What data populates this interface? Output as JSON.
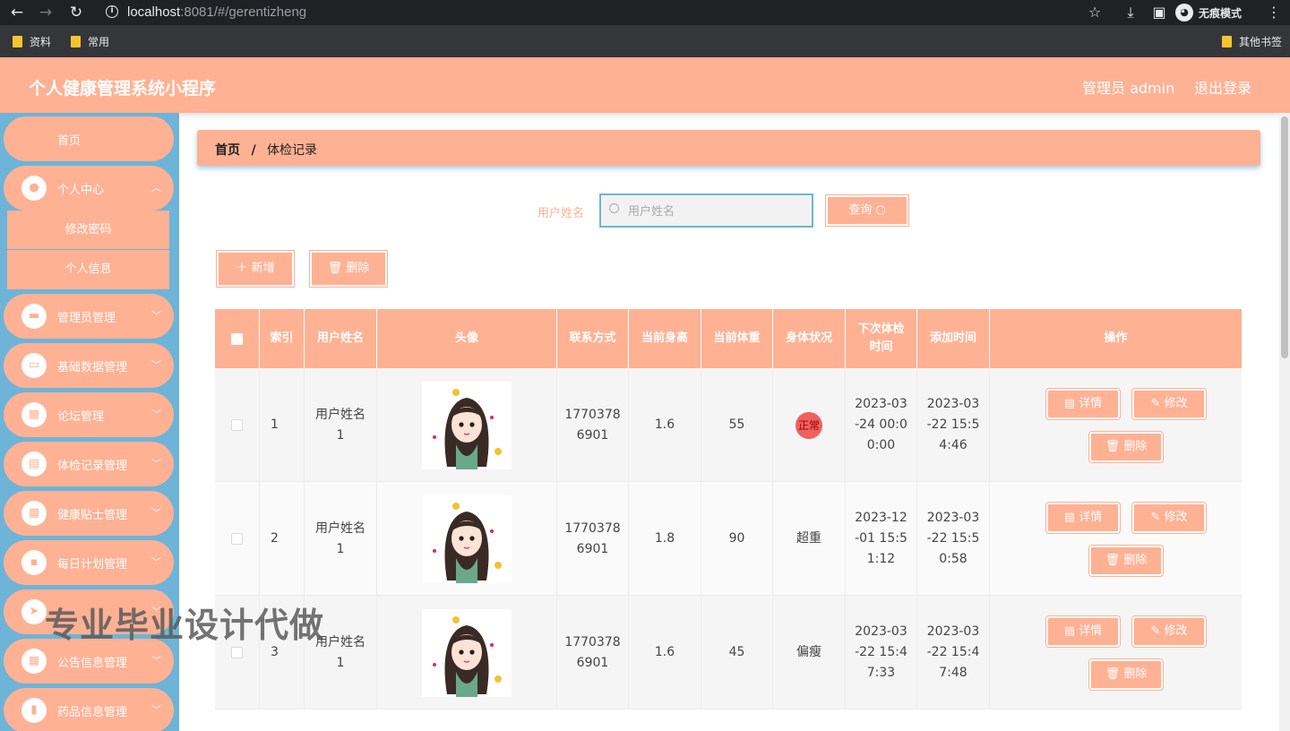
{
  "browser": {
    "url_host": "localhost",
    "url_rest": ":8081/#/gerentizheng",
    "incognito_label": "无痕模式",
    "bookmarks": [
      "资料",
      "常用"
    ],
    "other_bookmarks": "其他书签"
  },
  "header": {
    "title": "个人健康管理系统小程序",
    "user": "管理员 admin",
    "logout": "退出登录"
  },
  "sidebar": {
    "home": "首页",
    "items": [
      {
        "label": "个人中心",
        "icon": "user-icon"
      },
      {
        "label": "管理员管理",
        "icon": "ticket-icon"
      },
      {
        "label": "基础数据管理",
        "icon": "monitor-icon"
      },
      {
        "label": "论坛管理",
        "icon": "grid-icon"
      },
      {
        "label": "体检记录管理",
        "icon": "chart-icon"
      },
      {
        "label": "健康贴士管理",
        "icon": "grid-icon"
      },
      {
        "label": "每日计划管理",
        "icon": "message-icon"
      },
      {
        "label": "",
        "icon": "send-icon"
      },
      {
        "label": "公告信息管理",
        "icon": "grid-icon"
      },
      {
        "label": "药品信息管理",
        "icon": "clipboard-icon"
      }
    ],
    "submenu": [
      "修改密码",
      "个人信息"
    ]
  },
  "breadcrumb": {
    "home": "首页",
    "sep": "/",
    "current": "体检记录"
  },
  "search": {
    "label": "用户姓名",
    "placeholder": "用户姓名",
    "button": "查询"
  },
  "toolbar": {
    "add": "新增",
    "delete": "删除"
  },
  "table": {
    "headers": [
      "索引",
      "用户姓名",
      "头像",
      "联系方式",
      "当前身高",
      "当前体重",
      "身体状况",
      "下次体检时间",
      "添加时间",
      "操作"
    ],
    "rows": [
      {
        "index": "1",
        "name": "用户姓名1",
        "phone": "17703786901",
        "height": "1.6",
        "weight": "55",
        "status": "正常",
        "next": "2023-03-24 00:00:00",
        "added": "2023-03-22 15:54:46"
      },
      {
        "index": "2",
        "name": "用户姓名1",
        "phone": "17703786901",
        "height": "1.8",
        "weight": "90",
        "status": "超重",
        "next": "2023-12-01 15:51:12",
        "added": "2023-03-22 15:50:58"
      },
      {
        "index": "3",
        "name": "用户姓名1",
        "phone": "17703786901",
        "height": "1.6",
        "weight": "45",
        "status": "偏瘦",
        "next": "2023-03-22 15:47:33",
        "added": "2023-03-22 15:47:48"
      }
    ],
    "actions": {
      "detail": "详情",
      "edit": "修改",
      "delete": "删除"
    }
  },
  "watermark": "专业毕业设计代做",
  "colors": {
    "primary": "#ffb194",
    "sidebar": "#6db4d8"
  }
}
